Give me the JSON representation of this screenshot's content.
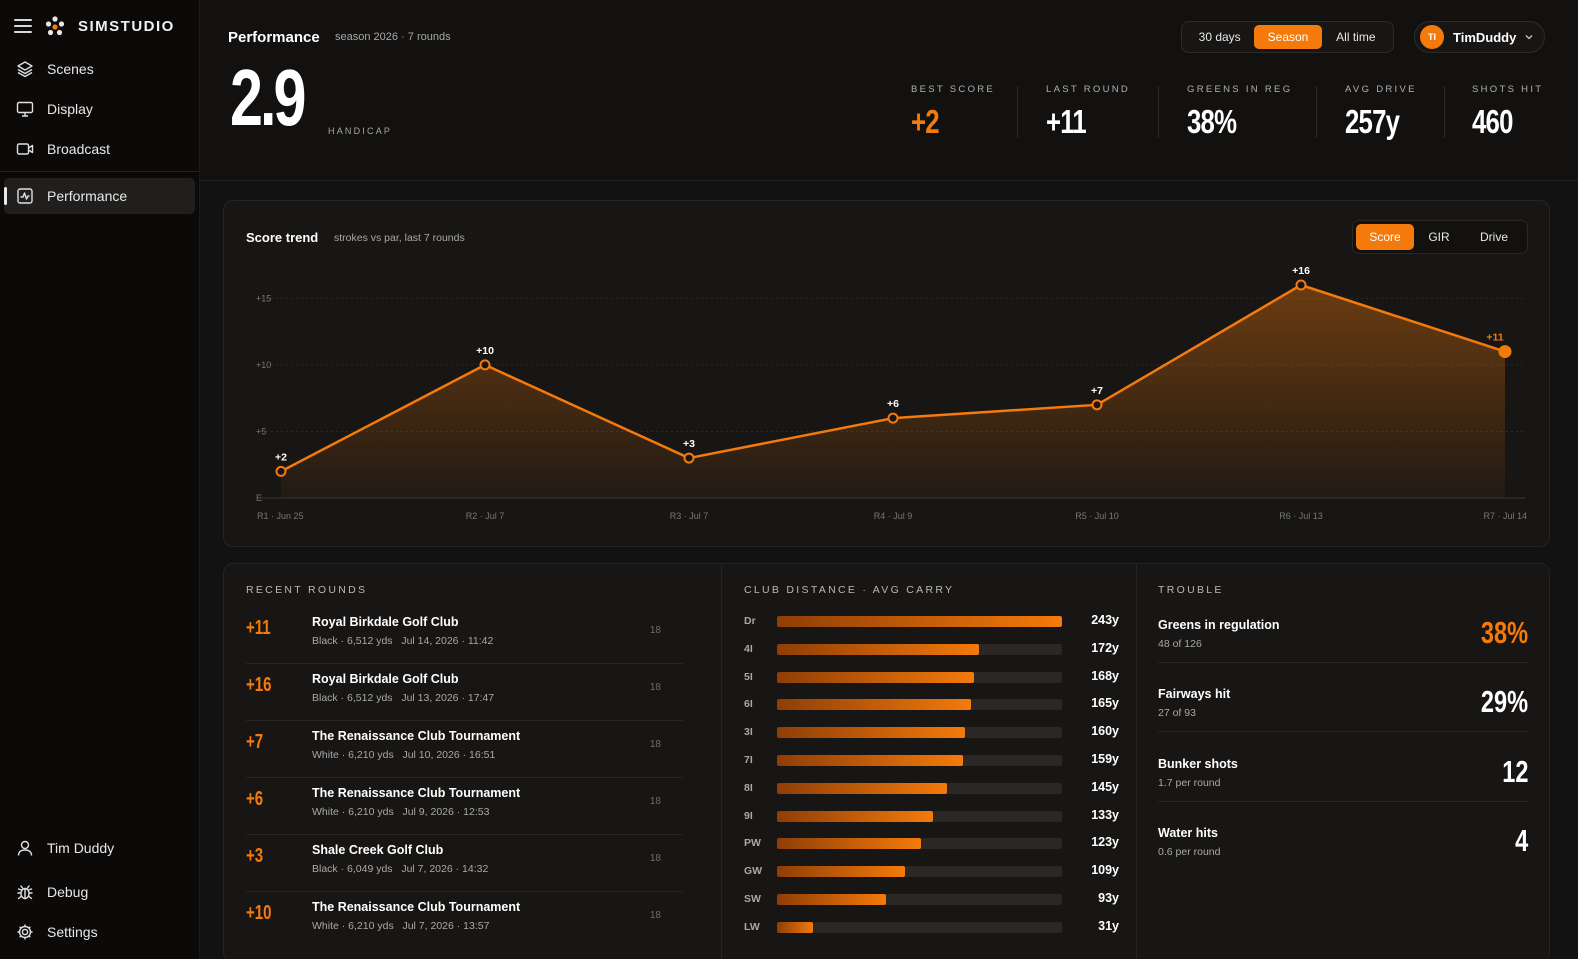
{
  "app": {
    "brand": "SIMSTUDIO"
  },
  "sidebar": {
    "items": [
      {
        "label": "Scenes",
        "icon": "layers-icon"
      },
      {
        "label": "Display",
        "icon": "monitor-icon"
      },
      {
        "label": "Broadcast",
        "icon": "video-camera-icon"
      },
      {
        "label": "Performance",
        "icon": "activity-chart-icon",
        "active": true
      }
    ],
    "bottom_items": [
      {
        "label": "Tim Duddy",
        "icon": "user-icon"
      },
      {
        "label": "Debug",
        "icon": "bug-icon"
      },
      {
        "label": "Settings",
        "icon": "gear-icon"
      }
    ]
  },
  "header": {
    "title": "Performance",
    "subtitle": "season 2026 · 7 rounds",
    "handicap_value": "2.9",
    "handicap_label": "HANDICAP",
    "range_options": [
      "30 days",
      "Season",
      "All time"
    ],
    "range_selected": "Season",
    "user": {
      "initials": "TI",
      "name": "TimDuddy"
    }
  },
  "kpis": [
    {
      "label": "BEST SCORE",
      "value": "+2",
      "accent": true
    },
    {
      "label": "LAST ROUND",
      "value": "+11",
      "accent": false
    },
    {
      "label": "GREENS IN REG",
      "value": "38%",
      "accent": false
    },
    {
      "label": "AVG DRIVE",
      "value": "257y",
      "accent": false
    },
    {
      "label": "SHOTS HIT",
      "value": "460",
      "accent": false
    }
  ],
  "trend": {
    "title": "Score trend",
    "subtitle": "strokes vs par, last 7 rounds",
    "toggle_options": [
      "Score",
      "GIR",
      "Drive"
    ],
    "toggle_selected": "Score"
  },
  "chart_data": {
    "type": "area",
    "categories": [
      "R1 · Jun 25",
      "R2 · Jul 7",
      "R3 · Jul 7",
      "R4 · Jul 9",
      "R5 · Jul 10",
      "R6 · Jul 13",
      "R7 · Jul 14"
    ],
    "values": [
      2,
      10,
      3,
      6,
      7,
      16,
      11
    ],
    "data_labels": [
      "+2",
      "+10",
      "+3",
      "+6",
      "+7",
      "+16",
      "+11"
    ],
    "y_ticks": [
      "E",
      "+5",
      "+10",
      "+15"
    ],
    "y_tick_values": [
      0,
      5,
      10,
      15
    ],
    "ylim": [
      0,
      16
    ],
    "color": "#f47a0b"
  },
  "recent_rounds": {
    "title": "RECENT ROUNDS",
    "rows": [
      {
        "score": "+11",
        "course": "Royal Birkdale Golf Club",
        "tee": "Black · 6,512 yds",
        "date": "Jul 14, 2026 · 11:42",
        "holes": "18"
      },
      {
        "score": "+16",
        "course": "Royal Birkdale Golf Club",
        "tee": "Black · 6,512 yds",
        "date": "Jul 13, 2026 · 17:47",
        "holes": "18"
      },
      {
        "score": "+7",
        "course": "The Renaissance Club Tournament",
        "tee": "White · 6,210 yds",
        "date": "Jul 10, 2026 · 16:51",
        "holes": "18"
      },
      {
        "score": "+6",
        "course": "The Renaissance Club Tournament",
        "tee": "White · 6,210 yds",
        "date": "Jul 9, 2026 · 12:53",
        "holes": "18"
      },
      {
        "score": "+3",
        "course": "Shale Creek Golf Club",
        "tee": "Black · 6,049 yds",
        "date": "Jul 7, 2026 · 14:32",
        "holes": "18"
      },
      {
        "score": "+10",
        "course": "The Renaissance Club Tournament",
        "tee": "White · 6,210 yds",
        "date": "Jul 7, 2026 · 13:57",
        "holes": "18"
      }
    ]
  },
  "club_distance": {
    "title": "CLUB DISTANCE · AVG CARRY",
    "max": 243,
    "clubs": [
      {
        "club": "Dr",
        "carry": 243,
        "label": "243y"
      },
      {
        "club": "4I",
        "carry": 172,
        "label": "172y"
      },
      {
        "club": "5I",
        "carry": 168,
        "label": "168y"
      },
      {
        "club": "6I",
        "carry": 165,
        "label": "165y"
      },
      {
        "club": "3I",
        "carry": 160,
        "label": "160y"
      },
      {
        "club": "7I",
        "carry": 159,
        "label": "159y"
      },
      {
        "club": "8I",
        "carry": 145,
        "label": "145y"
      },
      {
        "club": "9I",
        "carry": 133,
        "label": "133y"
      },
      {
        "club": "PW",
        "carry": 123,
        "label": "123y"
      },
      {
        "club": "GW",
        "carry": 109,
        "label": "109y"
      },
      {
        "club": "SW",
        "carry": 93,
        "label": "93y"
      },
      {
        "club": "LW",
        "carry": 31,
        "label": "31y"
      }
    ]
  },
  "trouble": {
    "title": "TROUBLE",
    "items": [
      {
        "name": "Greens in regulation",
        "sub": "48 of 126",
        "value": "38%",
        "accent": true
      },
      {
        "name": "Fairways hit",
        "sub": "27 of 93",
        "value": "29%",
        "accent": false
      },
      {
        "name": "Bunker shots",
        "sub": "1.7 per round",
        "value": "12",
        "accent": false
      },
      {
        "name": "Water hits",
        "sub": "0.6 per round",
        "value": "4",
        "accent": false
      }
    ]
  },
  "colors": {
    "accent": "#f47a0b",
    "background": "#121212",
    "card": "#181614"
  }
}
